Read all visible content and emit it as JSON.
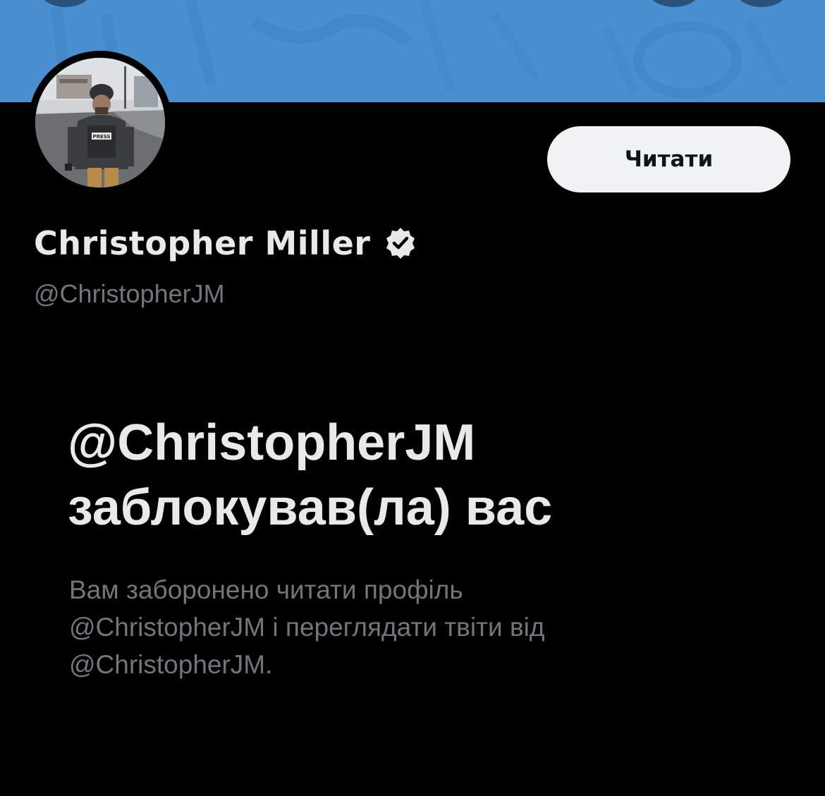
{
  "header": {
    "banner_color": "#4a90d0",
    "banner_icon": "profile-banner-image"
  },
  "profile": {
    "avatar_icon": "profile-photo",
    "follow_button_label": "Читати",
    "display_name": "Christopher Miller",
    "verified_icon": "verified-badge-icon",
    "handle": "@ChristopherJM"
  },
  "blocked": {
    "title_line1": "@ChristopherJM",
    "title_line2": "заблокував(ла) вас",
    "message_line1": "Вам заборонено читати профіль",
    "message_line2": "@ChristopherJM і переглядати твіти від",
    "message_line3": "@ChristopherJM."
  },
  "colors": {
    "background": "#000000",
    "primary_text": "#e7e9ea",
    "secondary_text": "#71767b",
    "button_bg": "#eff3f4",
    "button_text": "#0f1419"
  }
}
